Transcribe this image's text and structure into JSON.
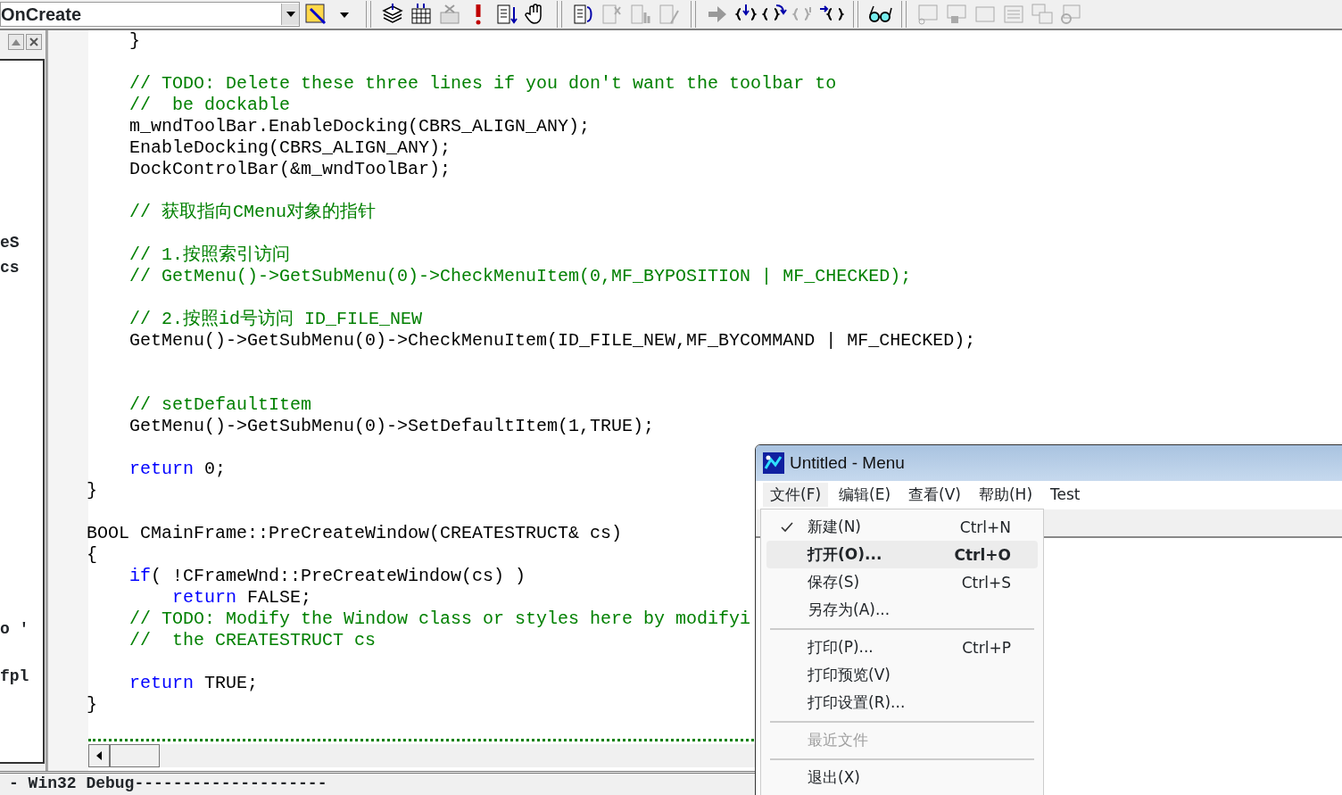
{
  "toolbar": {
    "function_combo": {
      "value": "OnCreate"
    }
  },
  "left_panel": {
    "fragments": [
      "eS",
      "cs",
      "o '",
      "fpl"
    ]
  },
  "code": [
    {
      "kind": "code",
      "segments": [
        {
          "kind": "plain",
          "text": "    }"
        }
      ]
    },
    {
      "kind": "blank"
    },
    {
      "kind": "code",
      "segments": [
        {
          "kind": "comment",
          "text": "    // TODO: Delete these three lines if you don't want the toolbar to"
        }
      ]
    },
    {
      "kind": "code",
      "segments": [
        {
          "kind": "comment",
          "text": "    //  be dockable"
        }
      ]
    },
    {
      "kind": "code",
      "segments": [
        {
          "kind": "plain",
          "text": "    m_wndToolBar.EnableDocking(CBRS_ALIGN_ANY);"
        }
      ]
    },
    {
      "kind": "code",
      "segments": [
        {
          "kind": "plain",
          "text": "    EnableDocking(CBRS_ALIGN_ANY);"
        }
      ]
    },
    {
      "kind": "code",
      "segments": [
        {
          "kind": "plain",
          "text": "    DockControlBar(&m_wndToolBar);"
        }
      ]
    },
    {
      "kind": "blank"
    },
    {
      "kind": "code",
      "segments": [
        {
          "kind": "comment",
          "text": "    // 获取指向CMenu对象的指针"
        }
      ]
    },
    {
      "kind": "blank"
    },
    {
      "kind": "code",
      "segments": [
        {
          "kind": "comment",
          "text": "    // 1.按照索引访问"
        }
      ]
    },
    {
      "kind": "code",
      "segments": [
        {
          "kind": "comment",
          "text": "    // GetMenu()->GetSubMenu(0)->CheckMenuItem(0,MF_BYPOSITION | MF_CHECKED);"
        }
      ]
    },
    {
      "kind": "blank"
    },
    {
      "kind": "code",
      "segments": [
        {
          "kind": "comment",
          "text": "    // 2.按照id号访问 ID_FILE_NEW"
        }
      ]
    },
    {
      "kind": "code",
      "segments": [
        {
          "kind": "plain",
          "text": "    GetMenu()->GetSubMenu(0)->CheckMenuItem(ID_FILE_NEW,MF_BYCOMMAND | MF_CHECKED);"
        }
      ]
    },
    {
      "kind": "blank"
    },
    {
      "kind": "blank"
    },
    {
      "kind": "code",
      "segments": [
        {
          "kind": "comment",
          "text": "    // setDefaultItem"
        }
      ]
    },
    {
      "kind": "code",
      "segments": [
        {
          "kind": "plain",
          "text": "    GetMenu()->GetSubMenu(0)->SetDefaultItem(1,TRUE);"
        }
      ]
    },
    {
      "kind": "blank"
    },
    {
      "kind": "code",
      "segments": [
        {
          "kind": "keyword",
          "text": "    return"
        },
        {
          "kind": "plain",
          "text": " 0;"
        }
      ]
    },
    {
      "kind": "code",
      "segments": [
        {
          "kind": "plain",
          "text": "}"
        }
      ]
    },
    {
      "kind": "blank"
    },
    {
      "kind": "code",
      "segments": [
        {
          "kind": "plain",
          "text": "BOOL CMainFrame::PreCreateWindow(CREATESTRUCT& cs)"
        }
      ]
    },
    {
      "kind": "code",
      "segments": [
        {
          "kind": "plain",
          "text": "{"
        }
      ]
    },
    {
      "kind": "code",
      "segments": [
        {
          "kind": "keyword",
          "text": "    if"
        },
        {
          "kind": "plain",
          "text": "( !CFrameWnd::PreCreateWindow(cs) )"
        }
      ]
    },
    {
      "kind": "code",
      "segments": [
        {
          "kind": "keyword",
          "text": "        return"
        },
        {
          "kind": "plain",
          "text": " FALSE;"
        }
      ]
    },
    {
      "kind": "code",
      "segments": [
        {
          "kind": "comment",
          "text": "    // TODO: Modify the Window class or styles here by modifyi"
        }
      ]
    },
    {
      "kind": "code",
      "segments": [
        {
          "kind": "comment",
          "text": "    //  the CREATESTRUCT cs"
        }
      ]
    },
    {
      "kind": "blank"
    },
    {
      "kind": "code",
      "segments": [
        {
          "kind": "keyword",
          "text": "    return"
        },
        {
          "kind": "plain",
          "text": " TRUE;"
        }
      ]
    },
    {
      "kind": "code",
      "segments": [
        {
          "kind": "plain",
          "text": "}"
        }
      ]
    }
  ],
  "output_bar": {
    "text": "- Win32 Debug--------------------"
  },
  "app_window": {
    "title": "Untitled - Menu",
    "menubar": [
      {
        "label": "文件(F)",
        "selected": true
      },
      {
        "label": "编辑(E)",
        "selected": false
      },
      {
        "label": "查看(V)",
        "selected": false
      },
      {
        "label": "帮助(H)",
        "selected": false
      },
      {
        "label": "Test",
        "selected": false
      }
    ],
    "file_menu": [
      {
        "kind": "item",
        "label": "新建(N)",
        "shortcut": "Ctrl+N",
        "checked": true,
        "default": false,
        "selected": false,
        "disabled": false
      },
      {
        "kind": "item",
        "label": "打开(O)...",
        "shortcut": "Ctrl+O",
        "checked": false,
        "default": true,
        "selected": true,
        "disabled": false
      },
      {
        "kind": "item",
        "label": "保存(S)",
        "shortcut": "Ctrl+S",
        "checked": false,
        "default": false,
        "selected": false,
        "disabled": false
      },
      {
        "kind": "item",
        "label": "另存为(A)...",
        "checked": false,
        "default": false,
        "selected": false,
        "disabled": false
      },
      {
        "kind": "separator"
      },
      {
        "kind": "item",
        "label": "打印(P)...",
        "shortcut": "Ctrl+P",
        "checked": false,
        "default": false,
        "selected": false,
        "disabled": false
      },
      {
        "kind": "item",
        "label": "打印预览(V)",
        "checked": false,
        "default": false,
        "selected": false,
        "disabled": false
      },
      {
        "kind": "item",
        "label": "打印设置(R)...",
        "checked": false,
        "default": false,
        "selected": false,
        "disabled": false
      },
      {
        "kind": "separator"
      },
      {
        "kind": "item",
        "label": "最近文件",
        "checked": false,
        "default": false,
        "selected": false,
        "disabled": true
      },
      {
        "kind": "separator"
      },
      {
        "kind": "item",
        "label": "退出(X)",
        "checked": false,
        "default": false,
        "selected": false,
        "disabled": false
      }
    ]
  }
}
